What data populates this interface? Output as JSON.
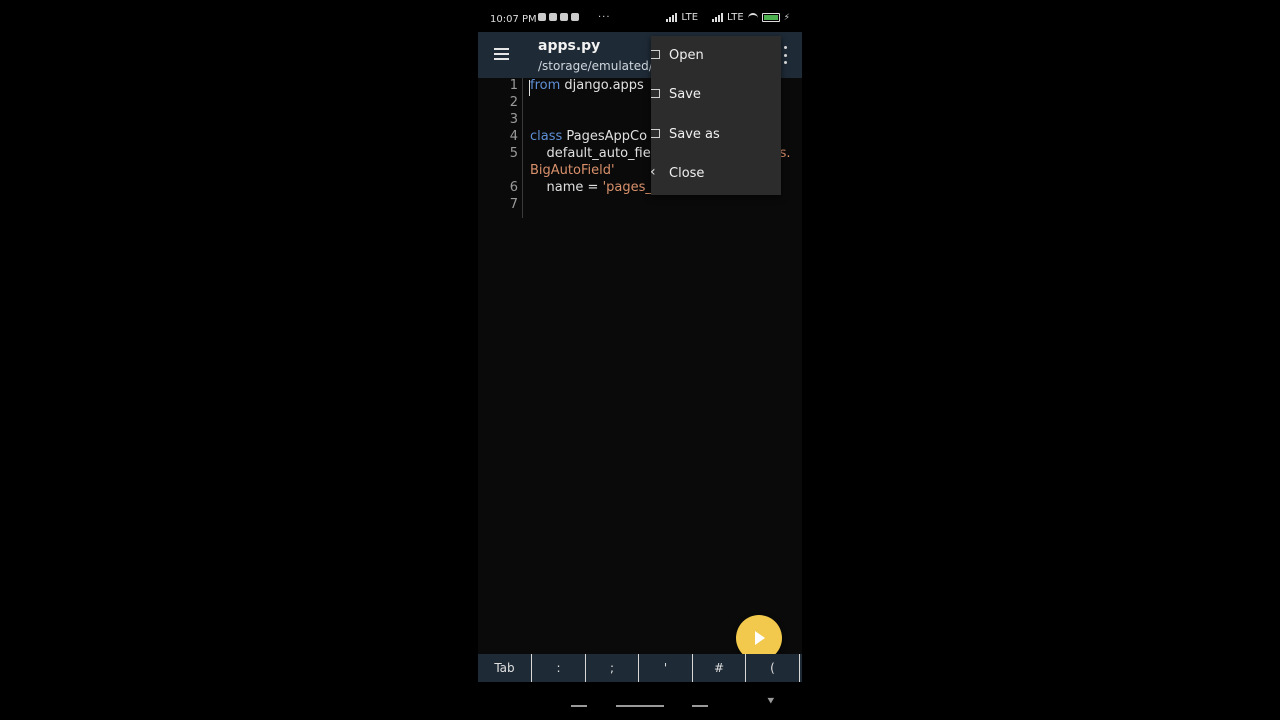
{
  "status_bar": {
    "time": "10:07 PM",
    "more": "···",
    "net1": "LTE",
    "net2": "LTE"
  },
  "app_bar": {
    "title": "apps.py",
    "path": "/storage/emulated/"
  },
  "editor": {
    "line_numbers": [
      "1",
      "2",
      "3",
      "4",
      "5",
      "6",
      "7"
    ],
    "lines": {
      "l1_kw": "from",
      "l1_rest": " django.apps",
      "l4_kw": "class",
      "l4_rest": " PagesAppCo",
      "l5_rest": "    default_auto_fiel",
      "l5_tail": "els.",
      "l5b": "BigAutoField'",
      "l6_rest": "    name = ",
      "l6_str": "'pages_a"
    }
  },
  "menu": {
    "items": [
      "Open",
      "Save",
      "Save as",
      "Close"
    ]
  },
  "keys": [
    "Tab",
    ":",
    ";",
    "'",
    "#",
    "("
  ],
  "colors": {
    "app_bar": "#1e2a36",
    "fab": "#f2c94c",
    "keyword": "#5f8fd6",
    "string": "#d9906b"
  }
}
